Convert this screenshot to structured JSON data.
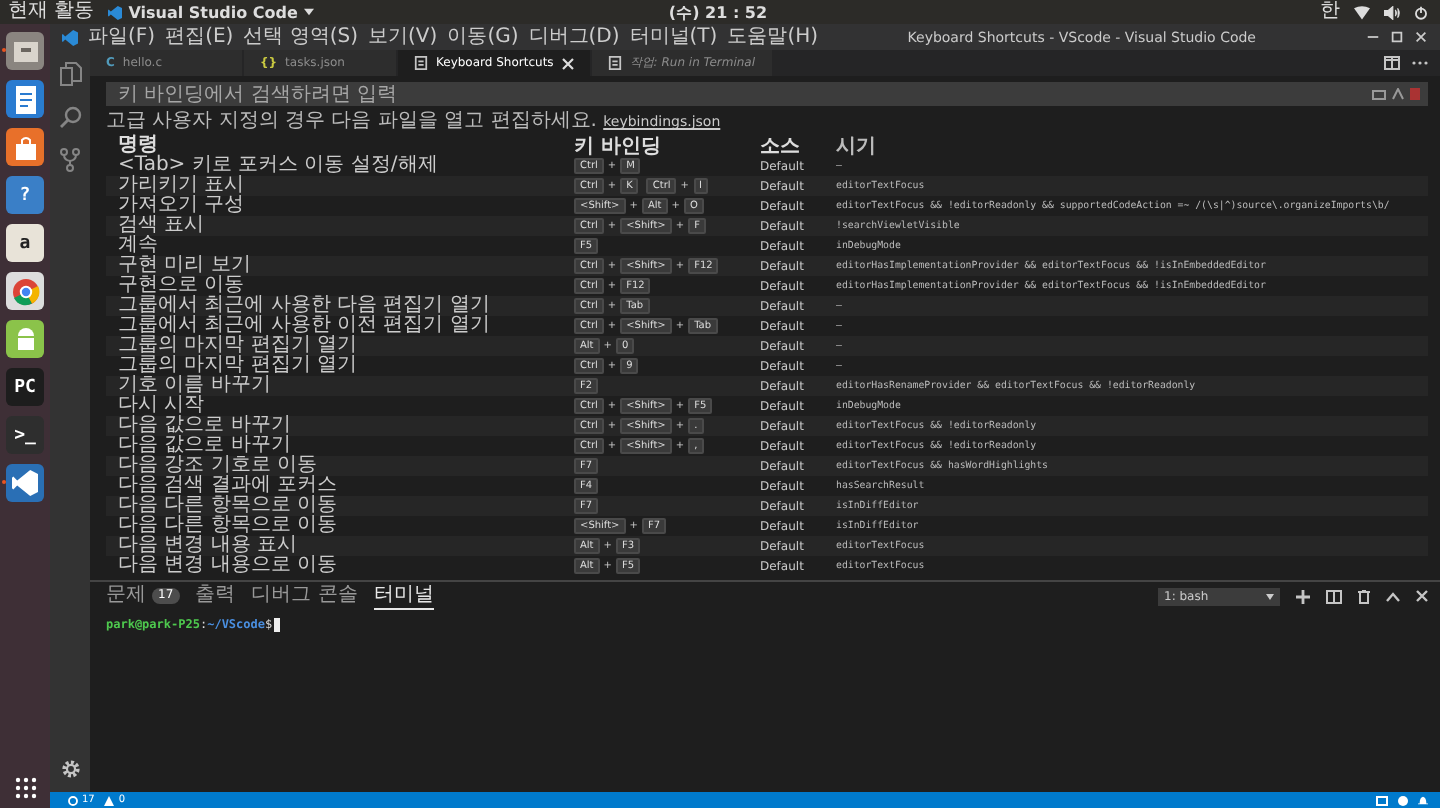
{
  "top_bar": {
    "activities": "현재 활동",
    "app_menu": "Visual Studio Code",
    "clock": "(수) 21 : 52",
    "input_method": "한"
  },
  "launcher": [
    {
      "kind": "files",
      "running": true
    },
    {
      "kind": "writer",
      "running": false
    },
    {
      "kind": "software",
      "running": false
    },
    {
      "kind": "help",
      "glyph": "?",
      "running": false
    },
    {
      "kind": "amazon",
      "glyph": "a",
      "running": false
    },
    {
      "kind": "chrome",
      "running": false
    },
    {
      "kind": "android",
      "running": false
    },
    {
      "kind": "pycharm",
      "glyph": "PC",
      "running": false
    },
    {
      "kind": "terminal",
      "glyph": ">_",
      "running": false
    },
    {
      "kind": "vscode",
      "running": true
    }
  ],
  "window": {
    "title": "Keyboard Shortcuts - VScode - Visual Studio Code",
    "menu": [
      "파일(F)",
      "편집(E)",
      "선택 영역(S)",
      "보기(V)",
      "이동(G)",
      "디버그(D)",
      "터미널(T)",
      "도움말(H)"
    ]
  },
  "tabs": [
    {
      "label": "hello.c",
      "kind": "c",
      "glyph": "C",
      "selected": false,
      "preview": false
    },
    {
      "label": "tasks.json",
      "kind": "json",
      "glyph": "{}",
      "selected": false,
      "preview": false
    },
    {
      "label": "Keyboard Shortcuts",
      "kind": "settings",
      "selected": true,
      "preview": false
    },
    {
      "label": "작업: Run in Terminal",
      "kind": "settings",
      "selected": false,
      "preview": true
    }
  ],
  "search": {
    "placeholder": "키 바인딩에서 검색하려면 입력"
  },
  "hint": {
    "text": "고급 사용자 지정의 경우 다음 파일을 열고 편집하세요.",
    "link": "keybindings.json"
  },
  "table": {
    "columns": [
      "명령",
      "키 바인딩",
      "소스",
      "시기"
    ],
    "key_joiner": "+",
    "rows": [
      {
        "command": "<Tab> 키로 포커스 이동 설정/해제",
        "keys": [
          [
            "Ctrl",
            "M"
          ]
        ],
        "source": "Default",
        "when": "—"
      },
      {
        "command": "가리키기 표시",
        "keys": [
          [
            "Ctrl",
            "K"
          ],
          [
            "Ctrl",
            "I"
          ]
        ],
        "source": "Default",
        "when": "editorTextFocus"
      },
      {
        "command": "가져오기 구성",
        "keys": [
          [
            "<Shift>",
            "Alt",
            "O"
          ]
        ],
        "source": "Default",
        "when": "editorTextFocus && !editorReadonly && supportedCodeAction =~ /(\\s|^)source\\.organizeImports\\b/"
      },
      {
        "command": "검색 표시",
        "keys": [
          [
            "Ctrl",
            "<Shift>",
            "F"
          ]
        ],
        "source": "Default",
        "when": "!searchViewletVisible"
      },
      {
        "command": "계속",
        "keys": [
          [
            "F5"
          ]
        ],
        "source": "Default",
        "when": "inDebugMode"
      },
      {
        "command": "구현 미리 보기",
        "keys": [
          [
            "Ctrl",
            "<Shift>",
            "F12"
          ]
        ],
        "source": "Default",
        "when": "editorHasImplementationProvider && editorTextFocus && !isInEmbeddedEditor"
      },
      {
        "command": "구현으로 이동",
        "keys": [
          [
            "Ctrl",
            "F12"
          ]
        ],
        "source": "Default",
        "when": "editorHasImplementationProvider && editorTextFocus && !isInEmbeddedEditor"
      },
      {
        "command": "그룹에서 최근에 사용한 다음 편집기 열기",
        "keys": [
          [
            "Ctrl",
            "Tab"
          ]
        ],
        "source": "Default",
        "when": "—"
      },
      {
        "command": "그룹에서 최근에 사용한 이전 편집기 열기",
        "keys": [
          [
            "Ctrl",
            "<Shift>",
            "Tab"
          ]
        ],
        "source": "Default",
        "when": "—"
      },
      {
        "command": "그룹의 마지막 편집기 열기",
        "keys": [
          [
            "Alt",
            "0"
          ]
        ],
        "source": "Default",
        "when": "—"
      },
      {
        "command": "그룹의 마지막 편집기 열기",
        "keys": [
          [
            "Ctrl",
            "9"
          ]
        ],
        "source": "Default",
        "when": "—"
      },
      {
        "command": "기호 이름 바꾸기",
        "keys": [
          [
            "F2"
          ]
        ],
        "source": "Default",
        "when": "editorHasRenameProvider && editorTextFocus && !editorReadonly"
      },
      {
        "command": "다시 시작",
        "keys": [
          [
            "Ctrl",
            "<Shift>",
            "F5"
          ]
        ],
        "source": "Default",
        "when": "inDebugMode"
      },
      {
        "command": "다음 값으로 바꾸기",
        "keys": [
          [
            "Ctrl",
            "<Shift>",
            "."
          ]
        ],
        "source": "Default",
        "when": "editorTextFocus && !editorReadonly"
      },
      {
        "command": "다음 값으로 바꾸기",
        "keys": [
          [
            "Ctrl",
            "<Shift>",
            ","
          ]
        ],
        "source": "Default",
        "when": "editorTextFocus && !editorReadonly"
      },
      {
        "command": "다음 강조 기호로 이동",
        "keys": [
          [
            "F7"
          ]
        ],
        "source": "Default",
        "when": "editorTextFocus && hasWordHighlights"
      },
      {
        "command": "다음 검색 결과에 포커스",
        "keys": [
          [
            "F4"
          ]
        ],
        "source": "Default",
        "when": "hasSearchResult"
      },
      {
        "command": "다음 다른 항목으로 이동",
        "keys": [
          [
            "F7"
          ]
        ],
        "source": "Default",
        "when": "isInDiffEditor"
      },
      {
        "command": "다음 다른 항목으로 이동",
        "keys": [
          [
            "<Shift>",
            "F7"
          ]
        ],
        "source": "Default",
        "when": "isInDiffEditor"
      },
      {
        "command": "다음 변경 내용 표시",
        "keys": [
          [
            "Alt",
            "F3"
          ]
        ],
        "source": "Default",
        "when": "editorTextFocus"
      },
      {
        "command": "다음 변경 내용으로 이동",
        "keys": [
          [
            "Alt",
            "F5"
          ]
        ],
        "source": "Default",
        "when": "editorTextFocus"
      }
    ]
  },
  "panel": {
    "tabs": [
      {
        "label": "문제",
        "badge": "17",
        "selected": false
      },
      {
        "label": "출력",
        "selected": false
      },
      {
        "label": "디버그 콘솔",
        "selected": false
      },
      {
        "label": "터미널",
        "selected": true
      }
    ],
    "terminal_picker": "1: bash",
    "prompt": {
      "user_host": "park@park-P25",
      "separator": ":",
      "path": "~/VScode",
      "symbol": "$"
    }
  },
  "status_bar": {
    "errors": "17",
    "warnings": "0"
  }
}
